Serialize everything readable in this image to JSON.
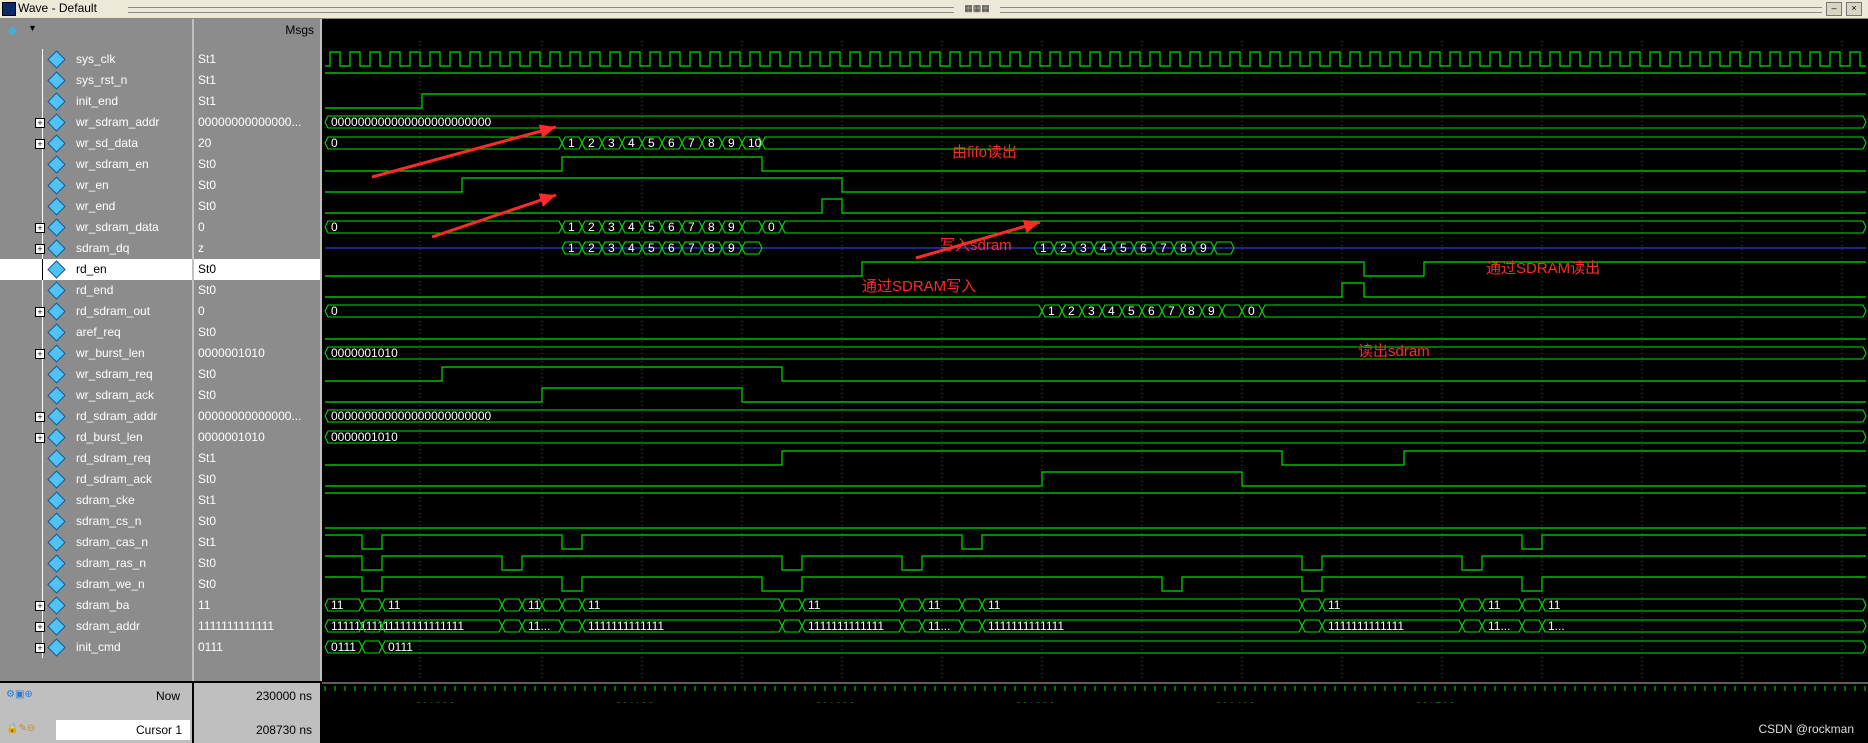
{
  "window": {
    "title": "Wave - Default"
  },
  "header": {
    "msgs_label": "Msgs"
  },
  "signals": [
    {
      "name": "sys_clk",
      "value": "St1",
      "bus": false
    },
    {
      "name": "sys_rst_n",
      "value": "St1",
      "bus": false
    },
    {
      "name": "init_end",
      "value": "St1",
      "bus": false
    },
    {
      "name": "wr_sdram_addr",
      "value": "00000000000000...",
      "bus": true
    },
    {
      "name": "wr_sd_data",
      "value": "20",
      "bus": true
    },
    {
      "name": "wr_sdram_en",
      "value": "St0",
      "bus": false
    },
    {
      "name": "wr_en",
      "value": "St0",
      "bus": false
    },
    {
      "name": "wr_end",
      "value": "St0",
      "bus": false
    },
    {
      "name": "wr_sdram_data",
      "value": "0",
      "bus": true
    },
    {
      "name": "sdram_dq",
      "value": "z",
      "bus": true
    },
    {
      "name": "rd_en",
      "value": "St0",
      "bus": false,
      "selected": true
    },
    {
      "name": "rd_end",
      "value": "St0",
      "bus": false
    },
    {
      "name": "rd_sdram_out",
      "value": "0",
      "bus": true
    },
    {
      "name": "aref_req",
      "value": "St0",
      "bus": false
    },
    {
      "name": "wr_burst_len",
      "value": "0000001010",
      "bus": true
    },
    {
      "name": "wr_sdram_req",
      "value": "St0",
      "bus": false
    },
    {
      "name": "wr_sdram_ack",
      "value": "St0",
      "bus": false
    },
    {
      "name": "rd_sdram_addr",
      "value": "00000000000000...",
      "bus": true
    },
    {
      "name": "rd_burst_len",
      "value": "0000001010",
      "bus": true
    },
    {
      "name": "rd_sdram_req",
      "value": "St1",
      "bus": false
    },
    {
      "name": "rd_sdram_ack",
      "value": "St0",
      "bus": false
    },
    {
      "name": "sdram_cke",
      "value": "St1",
      "bus": false
    },
    {
      "name": "sdram_cs_n",
      "value": "St0",
      "bus": false
    },
    {
      "name": "sdram_cas_n",
      "value": "St1",
      "bus": false
    },
    {
      "name": "sdram_ras_n",
      "value": "St0",
      "bus": false
    },
    {
      "name": "sdram_we_n",
      "value": "St0",
      "bus": false
    },
    {
      "name": "sdram_ba",
      "value": "11",
      "bus": true
    },
    {
      "name": "sdram_addr",
      "value": "1111111111111",
      "bus": true
    },
    {
      "name": "init_cmd",
      "value": "0111",
      "bus": true
    }
  ],
  "bus_labels": {
    "wr_sdram_addr": "000000000000000000000000",
    "wr_sd_data_init": "0",
    "wr_sdram_data_init": "0",
    "rd_sdram_out_init": "0",
    "burst_len": "0000001010",
    "rd_sdram_addr": "000000000000000000000000",
    "sdram_ba": "11",
    "sdram_addr_long": "1111111111...",
    "sdram_addr_full": "1111111111111",
    "sdram_addr_short": "11...",
    "sdram_addr_tiny": "1...",
    "init_cmd": "0111",
    "wr_sd_data_seq": [
      "1",
      "2",
      "3",
      "4",
      "5",
      "6",
      "7",
      "8",
      "9",
      "10"
    ],
    "wr_sdram_data_seq": [
      "1",
      "2",
      "3",
      "4",
      "5",
      "6",
      "7",
      "8",
      "9",
      "",
      "0"
    ],
    "dq_write_seq": [
      "1",
      "2",
      "3",
      "4",
      "5",
      "6",
      "7",
      "8",
      "9",
      ""
    ],
    "dq_read_seq": [
      "1",
      "2",
      "3",
      "4",
      "5",
      "6",
      "7",
      "8",
      "9",
      ""
    ],
    "rd_out_seq": [
      "1",
      "2",
      "3",
      "4",
      "5",
      "6",
      "7",
      "8",
      "9",
      "",
      "0"
    ]
  },
  "annotations": {
    "fifo": "由fifo读出",
    "write_sdram": "写入sdram",
    "through_write": "通过SDRAM写入",
    "through_read": "通过SDRAM读出",
    "read_sdram": "读出sdram"
  },
  "footer": {
    "now_label": "Now",
    "now_value": "230000 ns",
    "cursor_label": "Cursor 1",
    "cursor_value": "208730 ns",
    "ticks": [
      "201000 ns",
      "201100 ns",
      "201200 ns",
      "201300 ns",
      "201400 ns",
      "201500 ns"
    ]
  },
  "watermark": "CSDN @rockman",
  "colors": {
    "wave": "#00e000",
    "hiz": "#2f3fd8",
    "annotation": "#ff2a2a",
    "selected_row": "#ffffff"
  }
}
